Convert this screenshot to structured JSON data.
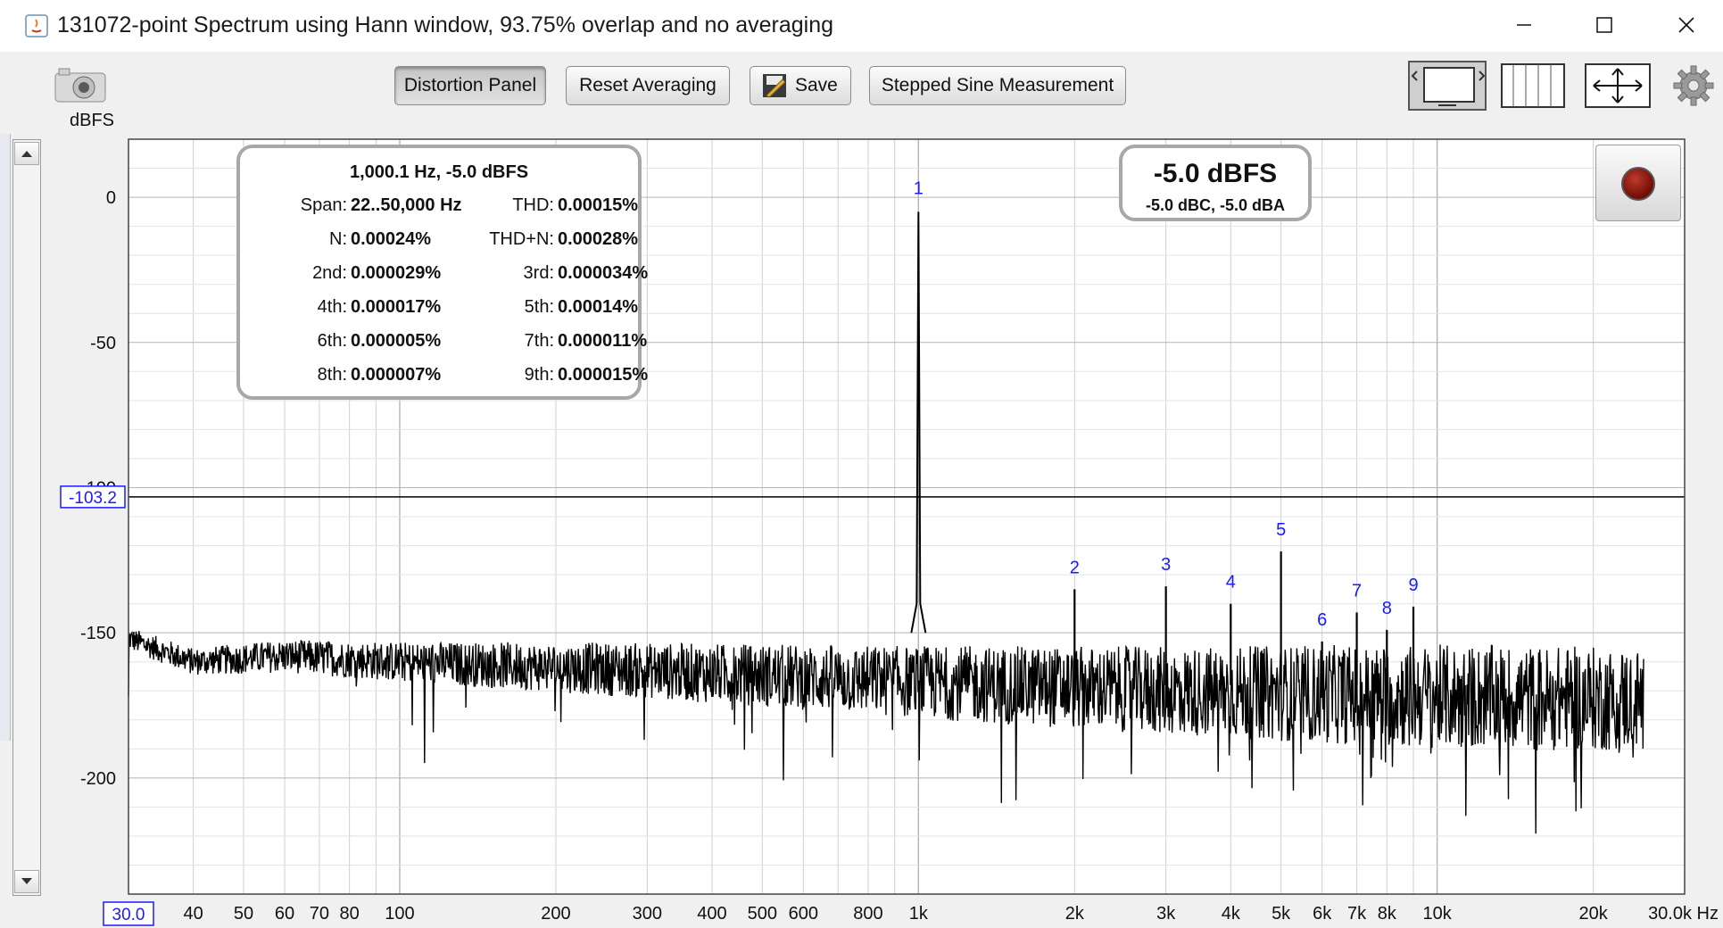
{
  "window": {
    "title": "131072-point Spectrum using Hann window, 93.75% overlap and no averaging"
  },
  "toolbar": {
    "distortion_panel": "Distortion Panel",
    "reset_averaging": "Reset Averaging",
    "save": "Save",
    "stepped_sine": "Stepped Sine Measurement"
  },
  "axis_unit": "dBFS",
  "distortion_panel": {
    "header": "1,000.1 Hz, -5.0 dBFS",
    "rows": [
      {
        "l1": "Span:",
        "v1": "22..50,000 Hz",
        "l2": "THD:",
        "v2": "0.00015%"
      },
      {
        "l1": "N:",
        "v1": "0.00024%",
        "l2": "THD+N:",
        "v2": "0.00028%"
      },
      {
        "l1": "2nd:",
        "v1": "0.000029%",
        "l2": "3rd:",
        "v2": "0.000034%"
      },
      {
        "l1": "4th:",
        "v1": "0.000017%",
        "l2": "5th:",
        "v2": "0.00014%"
      },
      {
        "l1": "6th:",
        "v1": "0.000005%",
        "l2": "7th:",
        "v2": "0.000011%"
      },
      {
        "l1": "8th:",
        "v1": "0.000007%",
        "l2": "9th:",
        "v2": "0.000015%"
      }
    ]
  },
  "level_panel": {
    "main": "-5.0 dBFS",
    "sub": "-5.0 dBC, -5.0 dBA"
  },
  "colors": {
    "trace": "#000000",
    "harmonic_labels": "#1a1aff",
    "grid": "#cfcfcf",
    "grid_major": "#b4b4b4"
  },
  "chart_data": {
    "type": "line",
    "x_scale": "log",
    "xlim": [
      30,
      30000
    ],
    "ylim": [
      -240,
      20
    ],
    "grid": true,
    "x_ticks": [
      {
        "v": 30,
        "label": "30.0"
      },
      {
        "v": 40,
        "label": "40"
      },
      {
        "v": 50,
        "label": "50"
      },
      {
        "v": 60,
        "label": "60"
      },
      {
        "v": 70,
        "label": "70"
      },
      {
        "v": 80,
        "label": "80"
      },
      {
        "v": 100,
        "label": "100"
      },
      {
        "v": 200,
        "label": "200"
      },
      {
        "v": 300,
        "label": "300"
      },
      {
        "v": 400,
        "label": "400"
      },
      {
        "v": 500,
        "label": "500"
      },
      {
        "v": 600,
        "label": "600"
      },
      {
        "v": 800,
        "label": "800"
      },
      {
        "v": 1000,
        "label": "1k"
      },
      {
        "v": 2000,
        "label": "2k"
      },
      {
        "v": 3000,
        "label": "3k"
      },
      {
        "v": 4000,
        "label": "4k"
      },
      {
        "v": 5000,
        "label": "5k"
      },
      {
        "v": 6000,
        "label": "6k"
      },
      {
        "v": 7000,
        "label": "7k"
      },
      {
        "v": 8000,
        "label": "8k"
      },
      {
        "v": 10000,
        "label": "10k"
      },
      {
        "v": 20000,
        "label": "20k"
      },
      {
        "v": 30000,
        "label": "30.0k Hz"
      }
    ],
    "y_ticks": [
      {
        "v": 0,
        "label": "0"
      },
      {
        "v": -50,
        "label": "-50"
      },
      {
        "v": -100,
        "label": "-100"
      },
      {
        "v": -150,
        "label": "-150"
      },
      {
        "v": -200,
        "label": "-200"
      }
    ],
    "cursor": {
      "y": -103.2,
      "y_label": "-103.2",
      "x_label": "30.0"
    },
    "fundamental": {
      "label": "1",
      "x": 1000.1,
      "y": -5.0
    },
    "harmonics": [
      {
        "label": "2",
        "x": 2000,
        "y": -135
      },
      {
        "label": "3",
        "x": 3000,
        "y": -134
      },
      {
        "label": "4",
        "x": 4000,
        "y": -140
      },
      {
        "label": "5",
        "x": 5000,
        "y": -122
      },
      {
        "label": "6",
        "x": 6000,
        "y": -153
      },
      {
        "label": "7",
        "x": 7000,
        "y": -143
      },
      {
        "label": "8",
        "x": 8000,
        "y": -149
      },
      {
        "label": "9",
        "x": 9000,
        "y": -141
      }
    ],
    "noise_floor": [
      {
        "x": 30,
        "y": -152
      },
      {
        "x": 40,
        "y": -160
      },
      {
        "x": 60,
        "y": -158
      },
      {
        "x": 100,
        "y": -160
      },
      {
        "x": 300,
        "y": -163
      },
      {
        "x": 1000,
        "y": -167
      },
      {
        "x": 3000,
        "y": -170
      },
      {
        "x": 10000,
        "y": -172
      },
      {
        "x": 25000,
        "y": -173
      }
    ],
    "trace_end_x": 25000
  }
}
